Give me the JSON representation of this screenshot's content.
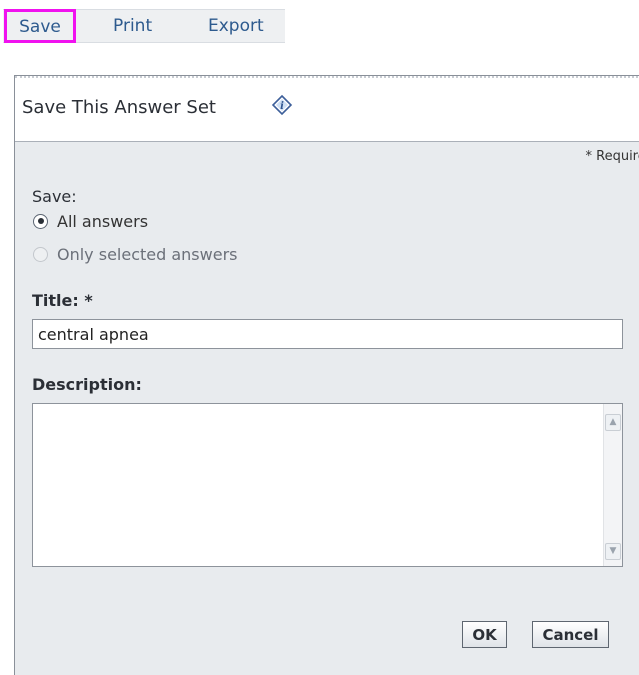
{
  "toolbar": {
    "save": "Save",
    "print": "Print",
    "export": "Export",
    "highlight_color": "#f012ef",
    "link_color": "#2d5a8e"
  },
  "dialog": {
    "title": "Save This Answer Set",
    "help_icon": "help-diamond-icon",
    "required_note": "* Required",
    "save_section": {
      "label": "Save:",
      "options": [
        {
          "label": "All answers",
          "selected": true,
          "enabled": true
        },
        {
          "label": "Only selected answers",
          "selected": false,
          "enabled": false
        }
      ]
    },
    "title_field": {
      "label": "Title: *",
      "value": "central apnea"
    },
    "description_field": {
      "label": "Description:",
      "value": ""
    },
    "buttons": {
      "ok": "OK",
      "cancel": "Cancel"
    }
  }
}
